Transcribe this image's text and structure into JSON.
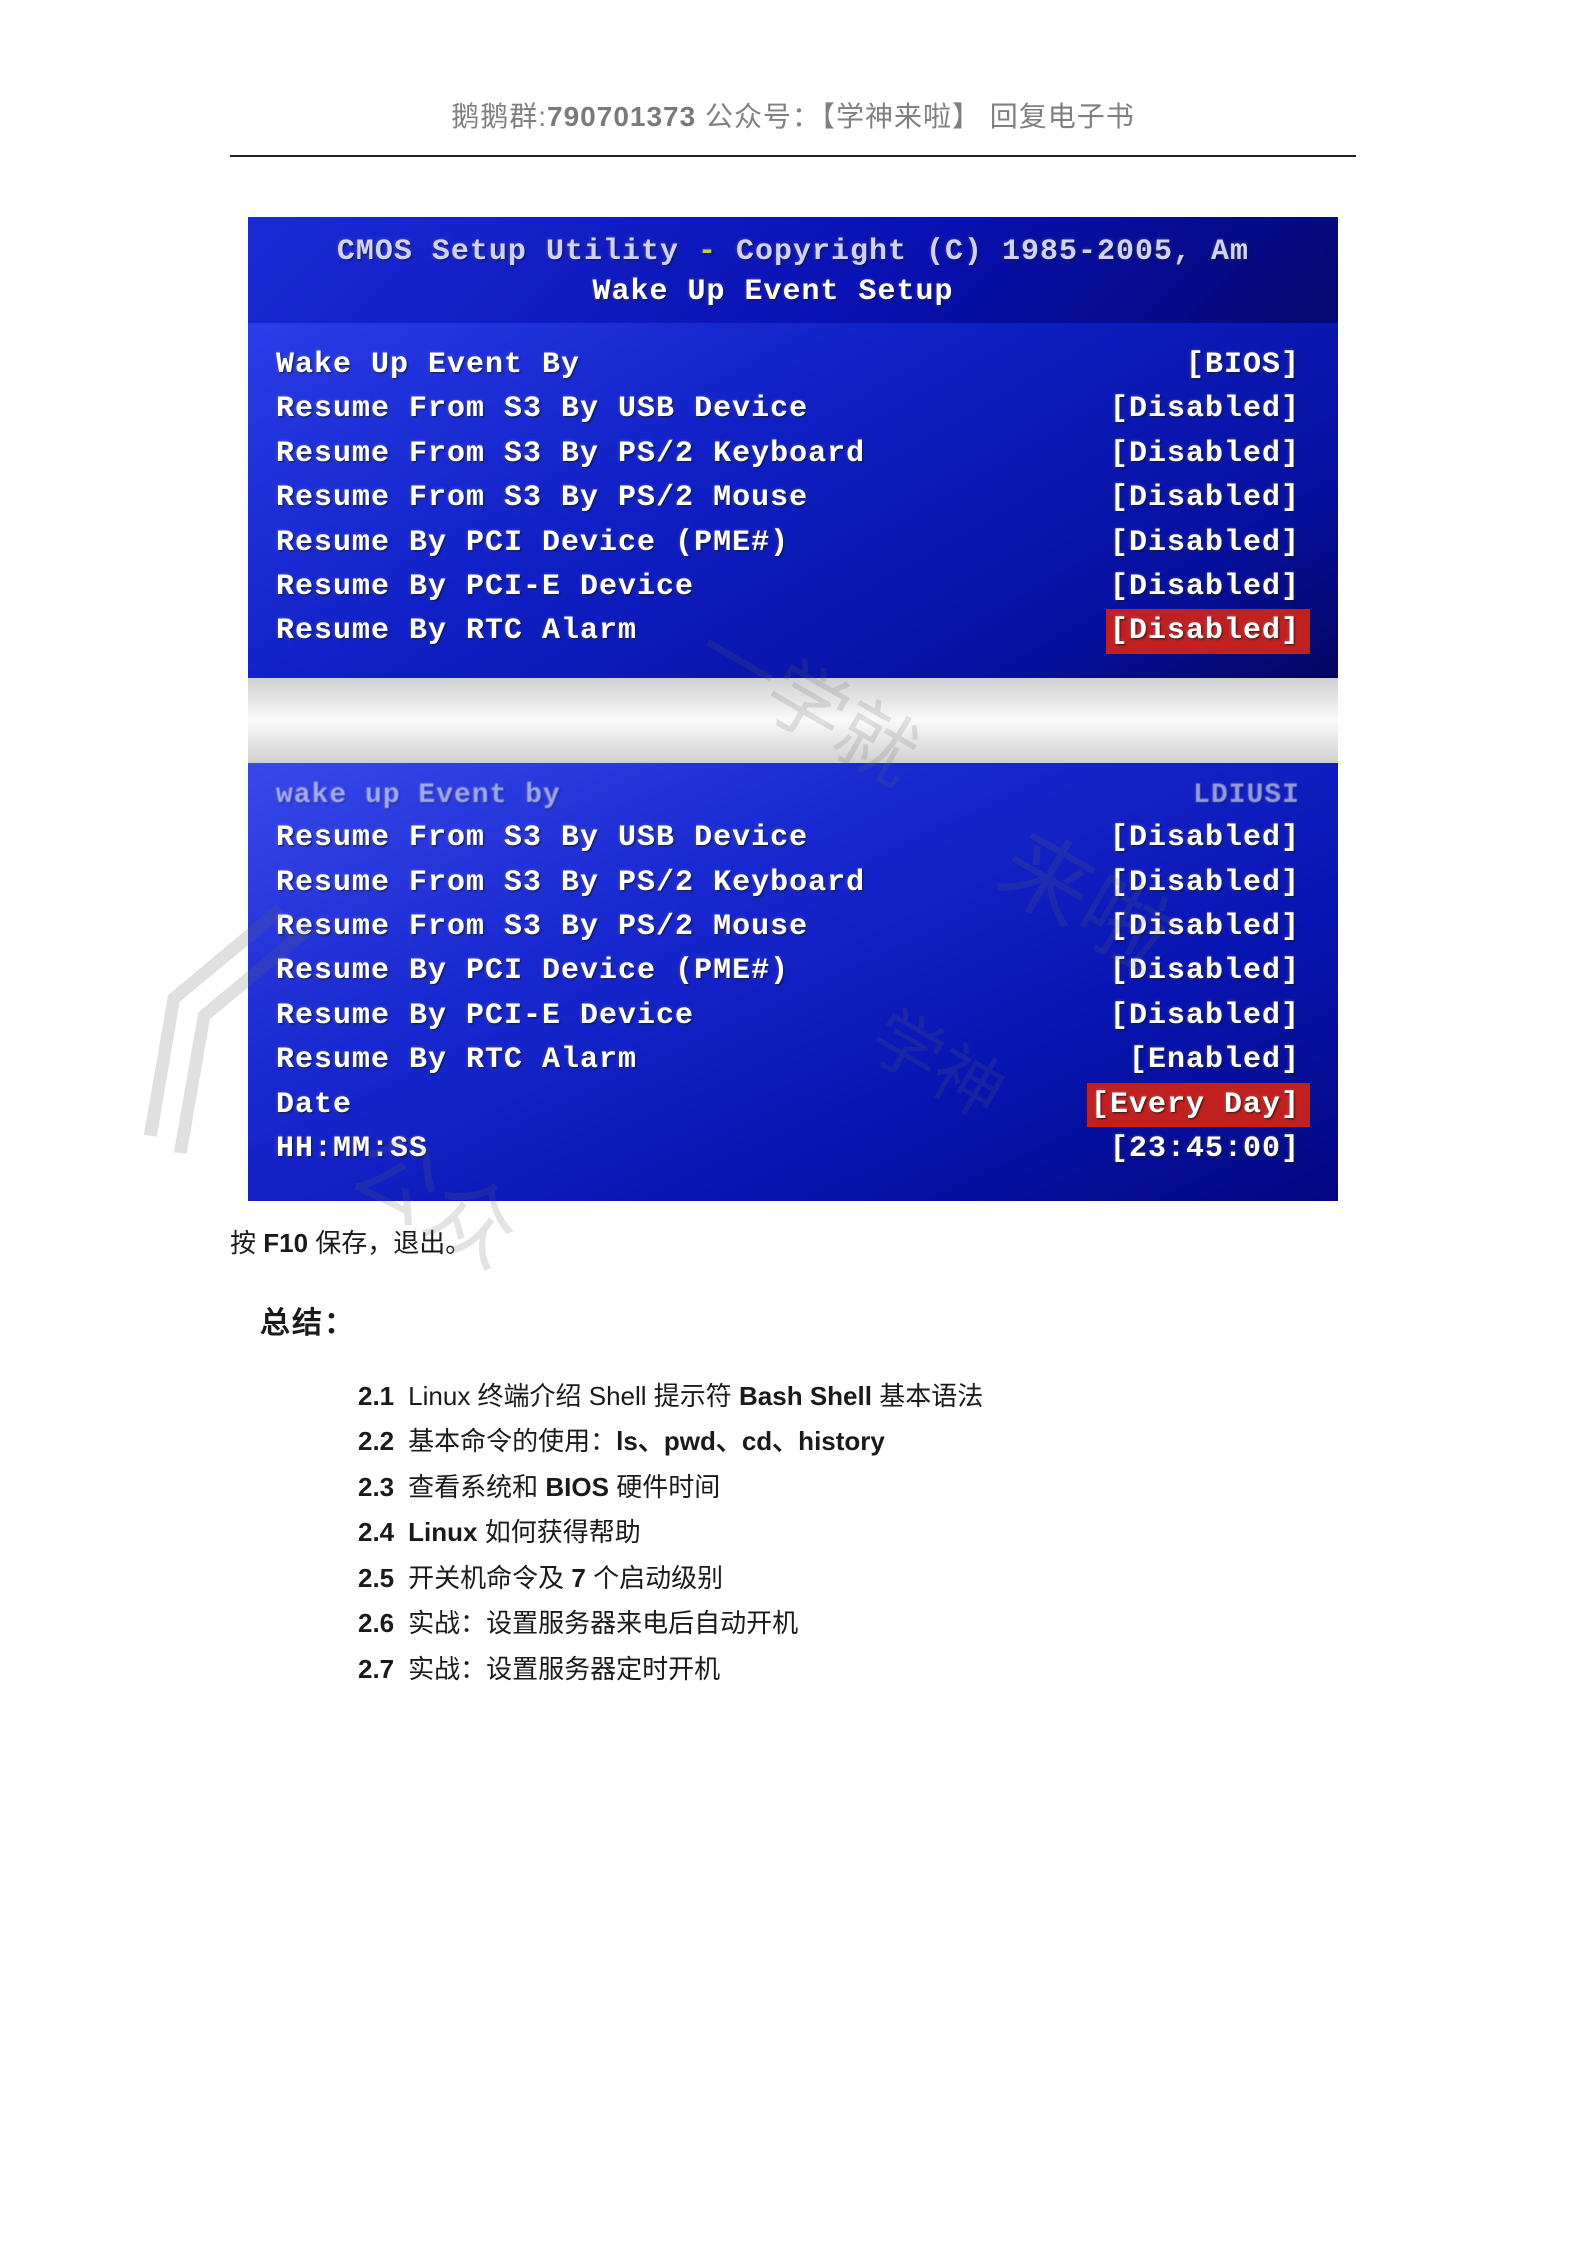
{
  "header": {
    "group_label": "鹅鹅群:",
    "group_number": "790701373",
    "spacer": "    ",
    "wechat_label": "公众号：【学神来啦】  回复电子书"
  },
  "bios": {
    "title_utility": "CMOS Setup Utility",
    "title_dash": " - ",
    "title_copyright": "Copyright (C) 1985-2005, Am",
    "title_sub": "Wake Up Event Setup",
    "panel1": [
      {
        "label": "Wake Up Event By",
        "value": "[BIOS]"
      },
      {
        "label": "Resume From S3 By USB Device",
        "value": "[Disabled]"
      },
      {
        "label": "Resume From S3 By PS/2 Keyboard",
        "value": "[Disabled]"
      },
      {
        "label": "Resume From S3 By PS/2 Mouse",
        "value": "[Disabled]"
      },
      {
        "label": "Resume By PCI Device (PME#)",
        "value": "[Disabled]"
      },
      {
        "label": "Resume By PCI-E Device",
        "value": "[Disabled]"
      },
      {
        "label": "Resume By RTC Alarm",
        "value": "[Disabled]",
        "highlight": true
      }
    ],
    "panel2_dim": {
      "label": "wake up Event by",
      "value": "LDIUSI"
    },
    "panel2": [
      {
        "label": "Resume From S3 By USB Device",
        "value": "[Disabled]"
      },
      {
        "label": "Resume From S3 By PS/2 Keyboard",
        "value": "[Disabled]"
      },
      {
        "label": "Resume From S3 By PS/2 Mouse",
        "value": "[Disabled]"
      },
      {
        "label": "Resume By PCI Device (PME#)",
        "value": "[Disabled]"
      },
      {
        "label": "Resume By PCI-E Device",
        "value": "[Disabled]"
      },
      {
        "label": "Resume By RTC Alarm",
        "value": "[Enabled]"
      },
      {
        "label": "Date",
        "value": "[Every Day]",
        "highlight": true
      },
      {
        "label": "HH:MM:SS",
        "value": "[23:45:00]"
      }
    ]
  },
  "text": {
    "save_prefix": "按 ",
    "save_key": "F10",
    "save_suffix": " 保存，退出。",
    "summary_title": "总结："
  },
  "summary": [
    {
      "num": "2.1",
      "content_parts": [
        "Linux 终端介绍 Shell 提示符 ",
        "Bash Shell",
        " 基本语法"
      ],
      "bold_idx": 1
    },
    {
      "num": "2.2",
      "content_parts": [
        "基本命令的使用：",
        "ls、pwd、cd、history"
      ],
      "bold_idx": 1
    },
    {
      "num": "2.3",
      "content_parts": [
        "查看系统和 ",
        "BIOS",
        " 硬件时间"
      ],
      "bold_idx": 1
    },
    {
      "num": "2.4",
      "content_parts": [
        "Linux",
        " 如何获得帮助"
      ],
      "bold_idx": 0
    },
    {
      "num": "2.5",
      "content_parts": [
        "开关机命令及 ",
        "7",
        " 个启动级别"
      ],
      "bold_idx": 1
    },
    {
      "num": "2.6",
      "content_parts": [
        "实战：设置服务器来电后自动开机"
      ],
      "bold_idx": -1
    },
    {
      "num": "2.7",
      "content_parts": [
        "实战：设置服务器定时开机"
      ],
      "bold_idx": -1
    }
  ],
  "watermarks": {
    "wm1": "一学就",
    "wm2": "来啦",
    "wm3": "公众",
    "wm4": "学神",
    "bracket": "《"
  }
}
